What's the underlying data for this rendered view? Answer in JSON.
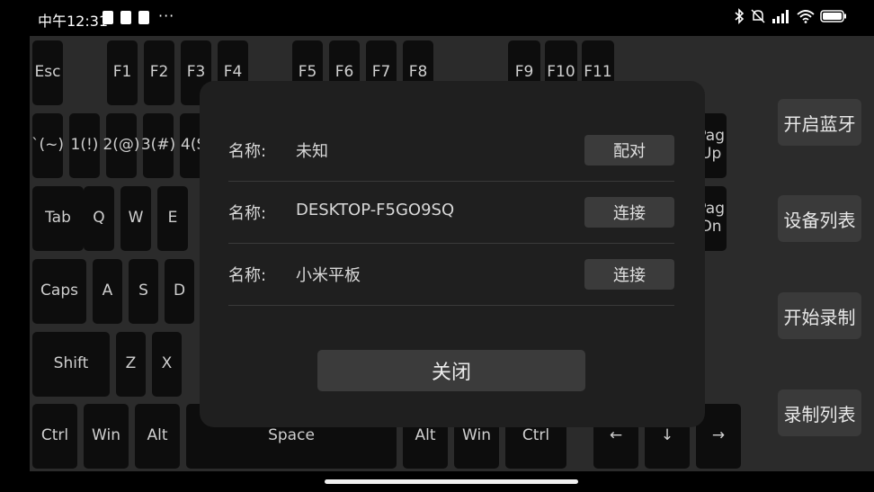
{
  "status_bar": {
    "time": "中午12:31",
    "overflow": "···",
    "icons": [
      "bluetooth-icon",
      "mute-icon",
      "signal-icon",
      "wifi-icon",
      "battery-icon"
    ]
  },
  "keyboard": {
    "row_fn": [
      "Esc",
      "F1",
      "F2",
      "F3",
      "F4",
      "F5",
      "F6",
      "F7",
      "F8",
      "F9",
      "F10",
      "F11"
    ],
    "row_num": [
      "`(~)",
      "1(!)",
      "2(@)",
      "3(#)",
      "4(S"
    ],
    "pgup": "Pag\nUp",
    "pgdn": "Pag\nDn",
    "row_tab": [
      "Tab",
      "Q",
      "W",
      "E"
    ],
    "row_caps": [
      "Caps",
      "A",
      "S",
      "D"
    ],
    "row_shift": [
      "Shift",
      "Z",
      "X"
    ],
    "row_ctrl": [
      "Ctrl",
      "Win",
      "Alt",
      "Space",
      "Alt",
      "Win",
      "Ctrl",
      "←",
      "↓",
      "→"
    ]
  },
  "side_panel": {
    "bluetooth_on": "开启蓝牙",
    "device_list": "设备列表",
    "start_record": "开始录制",
    "record_list": "录制列表"
  },
  "dialog": {
    "devices": [
      {
        "label": "名称:",
        "name": "未知",
        "action": "配对"
      },
      {
        "label": "名称:",
        "name": "DESKTOP-F5GO9SQ",
        "action": "连接"
      },
      {
        "label": "名称:",
        "name": "小米平板",
        "action": "连接"
      }
    ],
    "close_label": "关闭"
  }
}
